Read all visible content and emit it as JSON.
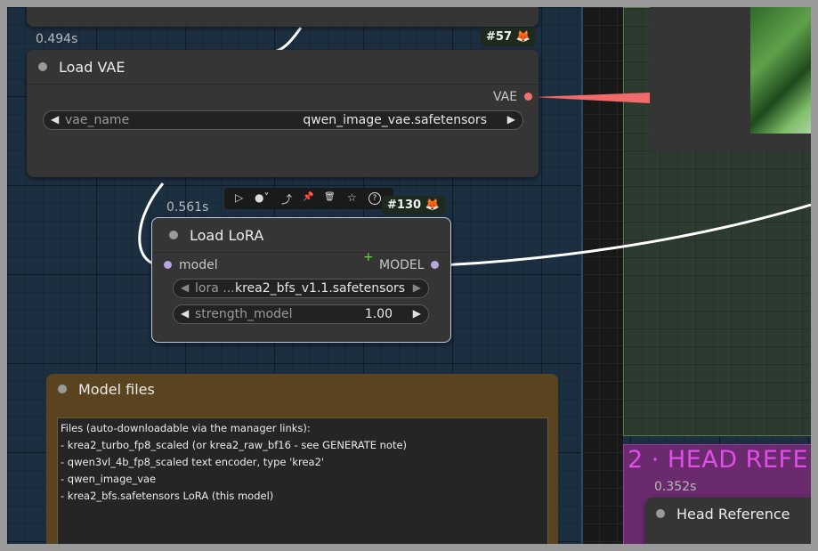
{
  "load_vae": {
    "time": "0.494s",
    "badge": "#57 🦊",
    "title": "Load VAE",
    "output_label": "VAE",
    "widget_label": "vae_name",
    "widget_value": "qwen_image_vae.safetensors"
  },
  "toolbar": {
    "play_icon": "▷",
    "color_icon": "●˅",
    "bypass_icon": "⤴",
    "pin_icon": "📌",
    "delete_icon": "🗑",
    "star_icon": "☆",
    "help_icon": "?"
  },
  "load_lora": {
    "time": "0.561s",
    "badge": "#130 🦊",
    "title": "Load LoRA",
    "input_label": "model",
    "output_label": "MODEL",
    "lora_label": "lora ...",
    "lora_value": "krea2_bfs_v1.1.safetensors",
    "strength_label": "strength_model",
    "strength_value": "1.00"
  },
  "model_files": {
    "title": "Model files",
    "lines": [
      "Files (auto-downloadable via the manager links):",
      "- krea2_turbo_fp8_scaled (or krea2_raw_bf16 - see GENERATE note)",
      "- qwen3vl_4b_fp8_scaled text encoder, type 'krea2'",
      "- qwen_image_vae",
      "- krea2_bfs.safetensors LoRA (this model)"
    ]
  },
  "head_group": {
    "title": "2 · HEAD REFE",
    "time": "0.352s",
    "node_title": "Head Reference"
  },
  "colors": {
    "vae_link": "#f26a6a",
    "model_link": "#ffffff",
    "model_socket": "#b9a4e0",
    "vae_socket": "#f27070",
    "green_group": "#2d3a2f",
    "purple_group": "#6a2a6e"
  }
}
